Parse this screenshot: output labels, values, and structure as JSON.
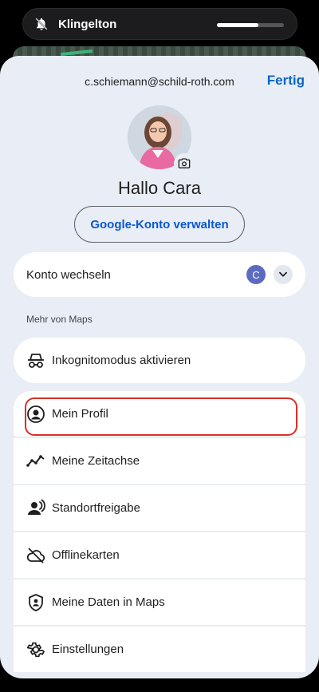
{
  "status": {
    "volume_label": "Klingelton",
    "volume_level": 0.62
  },
  "account": {
    "email": "c.schiemann@schild-roth.com",
    "done_label": "Fertig",
    "greeting": "Hallo Cara",
    "manage_label": "Google-Konto verwalten",
    "switch_label": "Konto wechseln",
    "switch_initial": "C"
  },
  "section": {
    "more_label": "Mehr von Maps"
  },
  "incognito": {
    "label": "Inkognitomodus aktivieren",
    "icon": "incognito-icon"
  },
  "menu": {
    "items": [
      {
        "label": "Mein Profil",
        "icon": "profile-icon"
      },
      {
        "label": "Meine Zeitachse",
        "icon": "timeline-icon"
      },
      {
        "label": "Standortfreigabe",
        "icon": "location-sharing-icon"
      },
      {
        "label": "Offlinekarten",
        "icon": "offline-cloud-icon"
      },
      {
        "label": "Meine Daten in Maps",
        "icon": "shield-icon"
      },
      {
        "label": "Einstellungen",
        "icon": "gear-icon"
      }
    ]
  },
  "colors": {
    "accent": "#0b57d0",
    "highlight": "#d93025",
    "sheet": "#e9edf5"
  }
}
